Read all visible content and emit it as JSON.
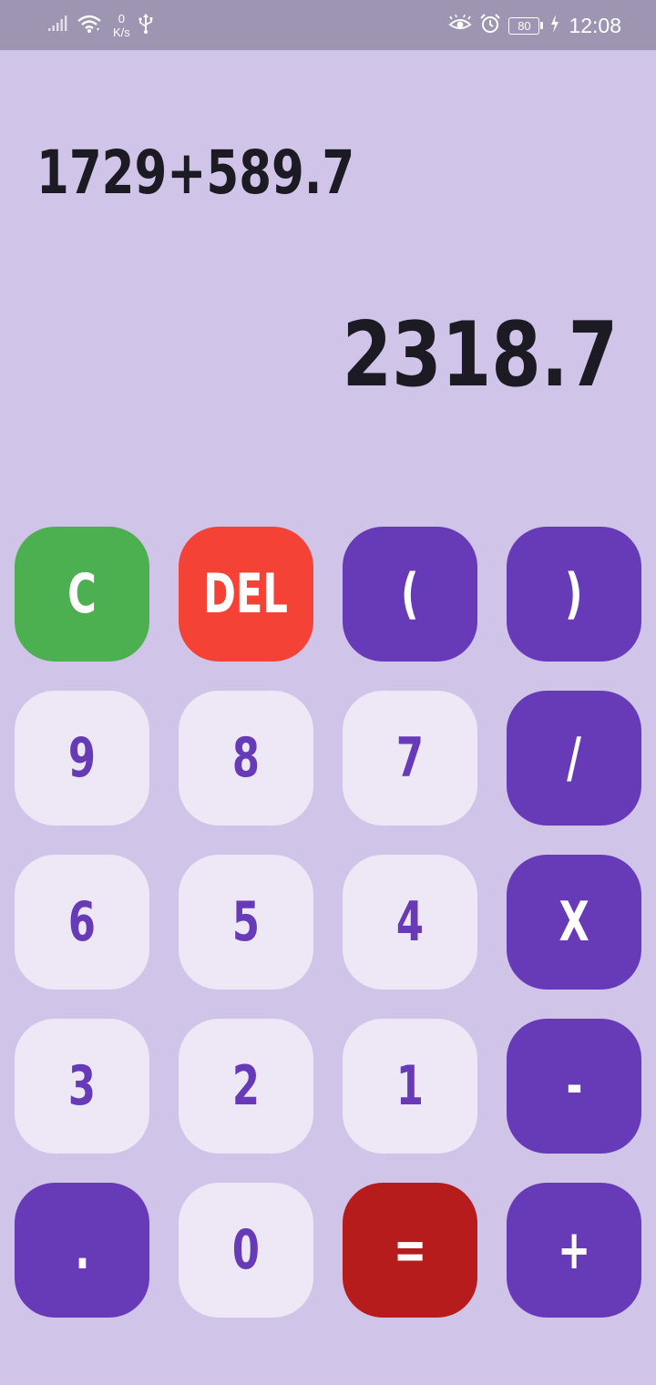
{
  "status_bar": {
    "net_speed_value": "0",
    "net_speed_unit": "K/s",
    "battery_level": "80",
    "clock": "12:08",
    "icons": [
      "signal-icon",
      "wifi-icon",
      "usb-icon",
      "eye-comfort-icon",
      "alarm-icon",
      "battery-icon",
      "charging-icon"
    ]
  },
  "display": {
    "expression": "1729+589.7",
    "result": "2318.7"
  },
  "keys": {
    "clear": "C",
    "delete": "DEL",
    "open_paren": "(",
    "close_paren": ")",
    "nine": "9",
    "eight": "8",
    "seven": "7",
    "divide": "/",
    "six": "6",
    "five": "5",
    "four": "4",
    "multiply": "X",
    "three": "3",
    "two": "2",
    "one": "1",
    "minus": "-",
    "decimal": ".",
    "zero": "0",
    "equals": "=",
    "plus": "+"
  },
  "colors": {
    "background": "#d1c4e9",
    "status_bar": "#9e95b2",
    "number_key": "#ede7f6",
    "operator_key": "#673ab7",
    "clear_key": "#4caf50",
    "delete_key": "#f44336",
    "equals_key": "#b71c1c",
    "display_text": "#1c1a22"
  }
}
